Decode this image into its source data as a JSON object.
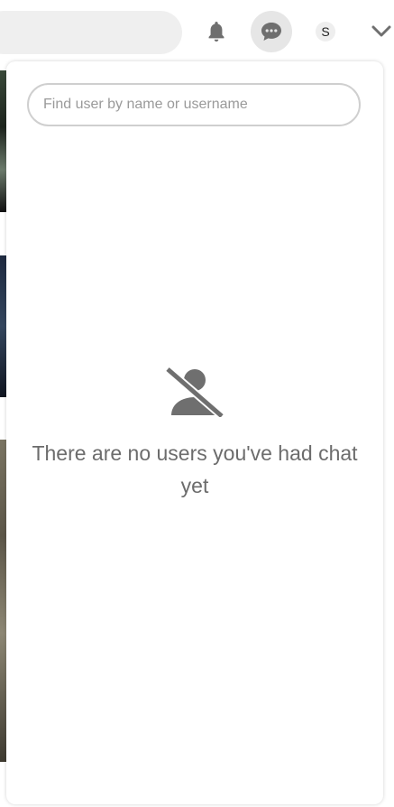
{
  "header": {
    "avatar_initial": "S",
    "icons": {
      "notifications": "bell-icon",
      "messages": "chat-bubble-icon",
      "menu": "chevron-down-icon"
    }
  },
  "chat_panel": {
    "search_placeholder": "Find user by name or username",
    "search_value": "",
    "empty_icon": "user-slash-icon",
    "empty_message": "There are no users you've had chat yet"
  },
  "colors": {
    "icon_gray": "#6f6f6f",
    "active_button_bg": "#e6e6e6",
    "search_bg": "#efefef"
  }
}
